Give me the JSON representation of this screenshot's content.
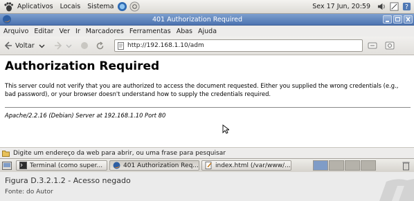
{
  "top_panel": {
    "menus": [
      "Aplicativos",
      "Locais",
      "Sistema"
    ],
    "clock": "Sex 17 Jun, 20:59"
  },
  "window": {
    "title": "401 Authorization Required"
  },
  "menubar": {
    "items": [
      "Arquivo",
      "Editar",
      "Ver",
      "Ir",
      "Marcadores",
      "Ferramentas",
      "Abas",
      "Ajuda"
    ]
  },
  "navbar": {
    "back_label": "Voltar",
    "url": "http://192.168.1.10/adm"
  },
  "page": {
    "heading": "Authorization Required",
    "paragraph": "This server could not verify that you are authorized to access the document requested. Either you supplied the wrong credentials (e.g., bad password), or your browser doesn't understand how to supply the credentials required.",
    "address": "Apache/2.2.16 (Debian) Server at 192.168.1.10 Port 80"
  },
  "statusbar": {
    "text": "Digite um endereço da web para abrir, ou uma frase para pesquisar"
  },
  "taskbar": {
    "tasks": [
      {
        "label": "Terminal (como super..."
      },
      {
        "label": "401 Authorization Req..."
      },
      {
        "label": "index.html (/var/www/..."
      }
    ]
  },
  "caption": {
    "figure": "Figura D.3.2.1.2 - Acesso negado",
    "source": "Fonte: do Autor"
  },
  "colors": {
    "titlebar": "#5a7fb8",
    "panel": "#e6e4df"
  }
}
